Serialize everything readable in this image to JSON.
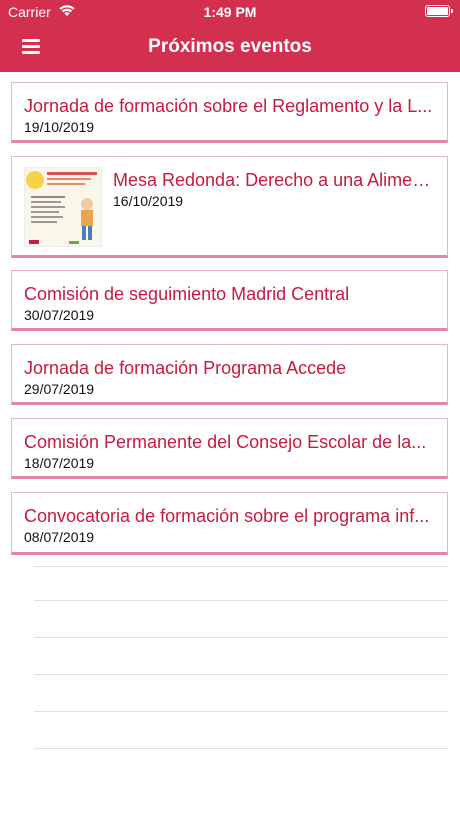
{
  "status_bar": {
    "carrier": "Carrier",
    "time": "1:49 PM"
  },
  "header": {
    "title": "Próximos eventos"
  },
  "events": [
    {
      "title": "Jornada de formación sobre el Reglamento y la L...",
      "date": "19/10/2019"
    },
    {
      "title": "Mesa Redonda: Derecho a una Alimen...",
      "date": "16/10/2019"
    },
    {
      "title": "Comisión de seguimiento Madrid Central",
      "date": "30/07/2019"
    },
    {
      "title": "Jornada de formación Programa Accede",
      "date": "29/07/2019"
    },
    {
      "title": "Comisión Permanente del Consejo Escolar de la...",
      "date": "18/07/2019"
    },
    {
      "title": "Convocatoria de formación sobre el programa inf...",
      "date": "08/07/2019"
    }
  ],
  "colors": {
    "brand": "#d3304f",
    "title_text": "#c8193f",
    "card_border": "#e08aa0"
  }
}
